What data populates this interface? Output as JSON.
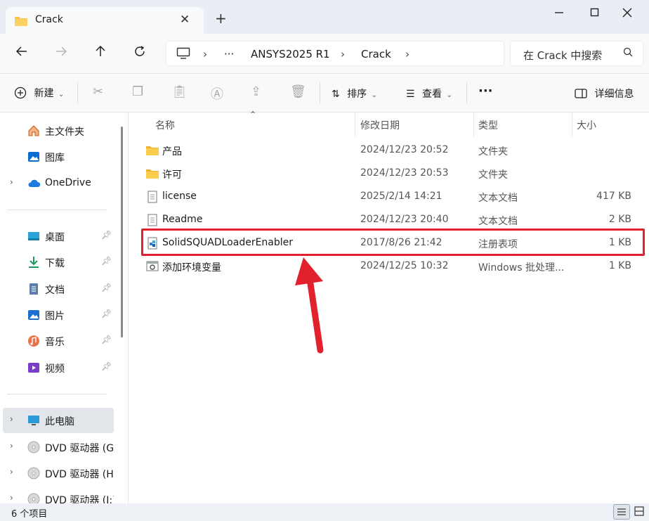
{
  "window": {
    "tab_title": "Crack",
    "tab_close": "✕",
    "new_tab": "+"
  },
  "nav": {
    "address_ellipsis": "···",
    "breadcrumb": [
      "ANSYS2025 R1",
      "Crack"
    ],
    "search_placeholder": "在 Crack 中搜索"
  },
  "toolbar": {
    "new_label": "新建",
    "sort_label": "排序",
    "view_label": "查看",
    "more_label": "···",
    "details_label": "详细信息"
  },
  "sidebar": {
    "quick": [
      {
        "label": "主文件夹",
        "icon": "home-icon"
      },
      {
        "label": "图库",
        "icon": "gallery-icon"
      },
      {
        "label": "OneDrive",
        "icon": "cloud-icon",
        "expandable": true
      }
    ],
    "pinned": [
      {
        "label": "桌面",
        "icon": "desktop-icon"
      },
      {
        "label": "下载",
        "icon": "download-icon"
      },
      {
        "label": "文档",
        "icon": "document-icon"
      },
      {
        "label": "图片",
        "icon": "pictures-icon"
      },
      {
        "label": "音乐",
        "icon": "music-icon"
      },
      {
        "label": "视频",
        "icon": "video-icon"
      }
    ],
    "drives": [
      {
        "label": "此电脑",
        "icon": "computer-icon",
        "selected": true
      },
      {
        "label": "DVD 驱动器 (G",
        "icon": "dvd-icon"
      },
      {
        "label": "DVD 驱动器 (H",
        "icon": "dvd-icon"
      },
      {
        "label": "DVD 驱动器 (I:)",
        "icon": "dvd-icon"
      }
    ]
  },
  "columns": {
    "name": "名称",
    "modified": "修改日期",
    "type": "类型",
    "size": "大小"
  },
  "files": [
    {
      "name": "产品",
      "modified": "2024/12/23 20:52",
      "type": "文件夹",
      "size": "",
      "icon": "folder-icon"
    },
    {
      "name": "许可",
      "modified": "2024/12/23 20:53",
      "type": "文件夹",
      "size": "",
      "icon": "folder-icon"
    },
    {
      "name": "license",
      "modified": "2025/2/14 14:21",
      "type": "文本文档",
      "size": "417 KB",
      "icon": "text-file-icon"
    },
    {
      "name": "Readme",
      "modified": "2024/12/23 20:40",
      "type": "文本文档",
      "size": "2 KB",
      "icon": "text-file-icon"
    },
    {
      "name": "SolidSQUADLoaderEnabler",
      "modified": "2017/8/26 21:42",
      "type": "注册表项",
      "size": "1 KB",
      "icon": "registry-file-icon"
    },
    {
      "name": "添加环境变量",
      "modified": "2024/12/25 10:32",
      "type": "Windows 批处理...",
      "size": "1 KB",
      "icon": "batch-file-icon"
    }
  ],
  "status": {
    "item_count": "6 个项目"
  },
  "colors": {
    "highlight": "#e1212d",
    "accent": "#0067c0",
    "folder": "#f8c34a"
  }
}
